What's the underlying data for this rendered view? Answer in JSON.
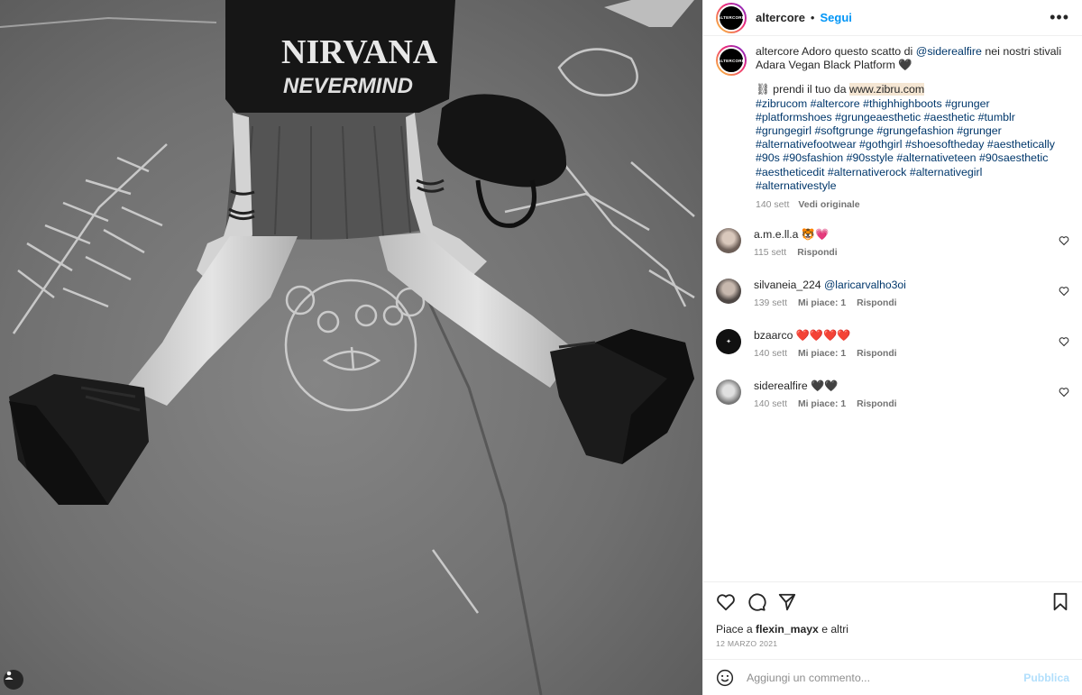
{
  "header": {
    "username": "altercore",
    "avatar_text": "ALTERCORE",
    "dot": "•",
    "follow_label": "Segui",
    "more_label": "•••"
  },
  "caption": {
    "username": "altercore",
    "text_before": "Adoro questo scatto di ",
    "mention": "@siderealfire",
    "text_after": " nei nostri stivali Adara Vegan Black Platform 🖤",
    "chain_icon": "⛓",
    "buy_text": " prendi il tuo da ",
    "link": "www.zibru.com",
    "hashtags": "#zibrucom #altercore #thighhighboots #grunger #platformshoes #grungeaesthetic #aesthetic #tumblr #grungegirl #softgrunge #grungefashion #grunger #alternativefootwear #gothgirl #shoesoftheday #aesthetically #90s #90sfashion #90sstyle #alternativeteen #90saesthetic #aestheticedit #alternativerock #alternativegirl #alternativestyle",
    "time": "140 sett",
    "see_original": "Vedi originale"
  },
  "comments": [
    {
      "user": "a.m.e.ll.a",
      "text": "🐯💗",
      "time": "115 sett",
      "likes": "",
      "reply": "Rispondi",
      "avatar_color": "#8a7f78"
    },
    {
      "user": "silvaneia_224",
      "text": "@laricarvalho3oi",
      "time": "139 sett",
      "likes": "Mi piace: 1",
      "reply": "Rispondi",
      "avatar_color": "#6b6460"
    },
    {
      "user": "bzaarco",
      "text": "❤️❤️❤️❤️",
      "time": "140 sett",
      "likes": "Mi piace: 1",
      "reply": "Rispondi",
      "avatar_color": "#111111"
    },
    {
      "user": "siderealfire",
      "text": "🖤🖤",
      "time": "140 sett",
      "likes": "Mi piace: 1",
      "reply": "Rispondi",
      "avatar_color": "#9a9a9a"
    }
  ],
  "footer": {
    "likes_prefix": "Piace a ",
    "likes_user": "flexin_mayx",
    "likes_suffix": " e altri",
    "date": "12 MARZO 2021",
    "comment_placeholder": "Aggiungi un commento...",
    "publish_label": "Pubblica"
  },
  "photo": {
    "shirt_line1": "NIRVANA",
    "shirt_line2": "NEVERMIND"
  },
  "colors": {
    "accent": "#0095f6",
    "link": "#00376b",
    "muted": "#8e8e8e",
    "heart_red": "#ed4956"
  }
}
